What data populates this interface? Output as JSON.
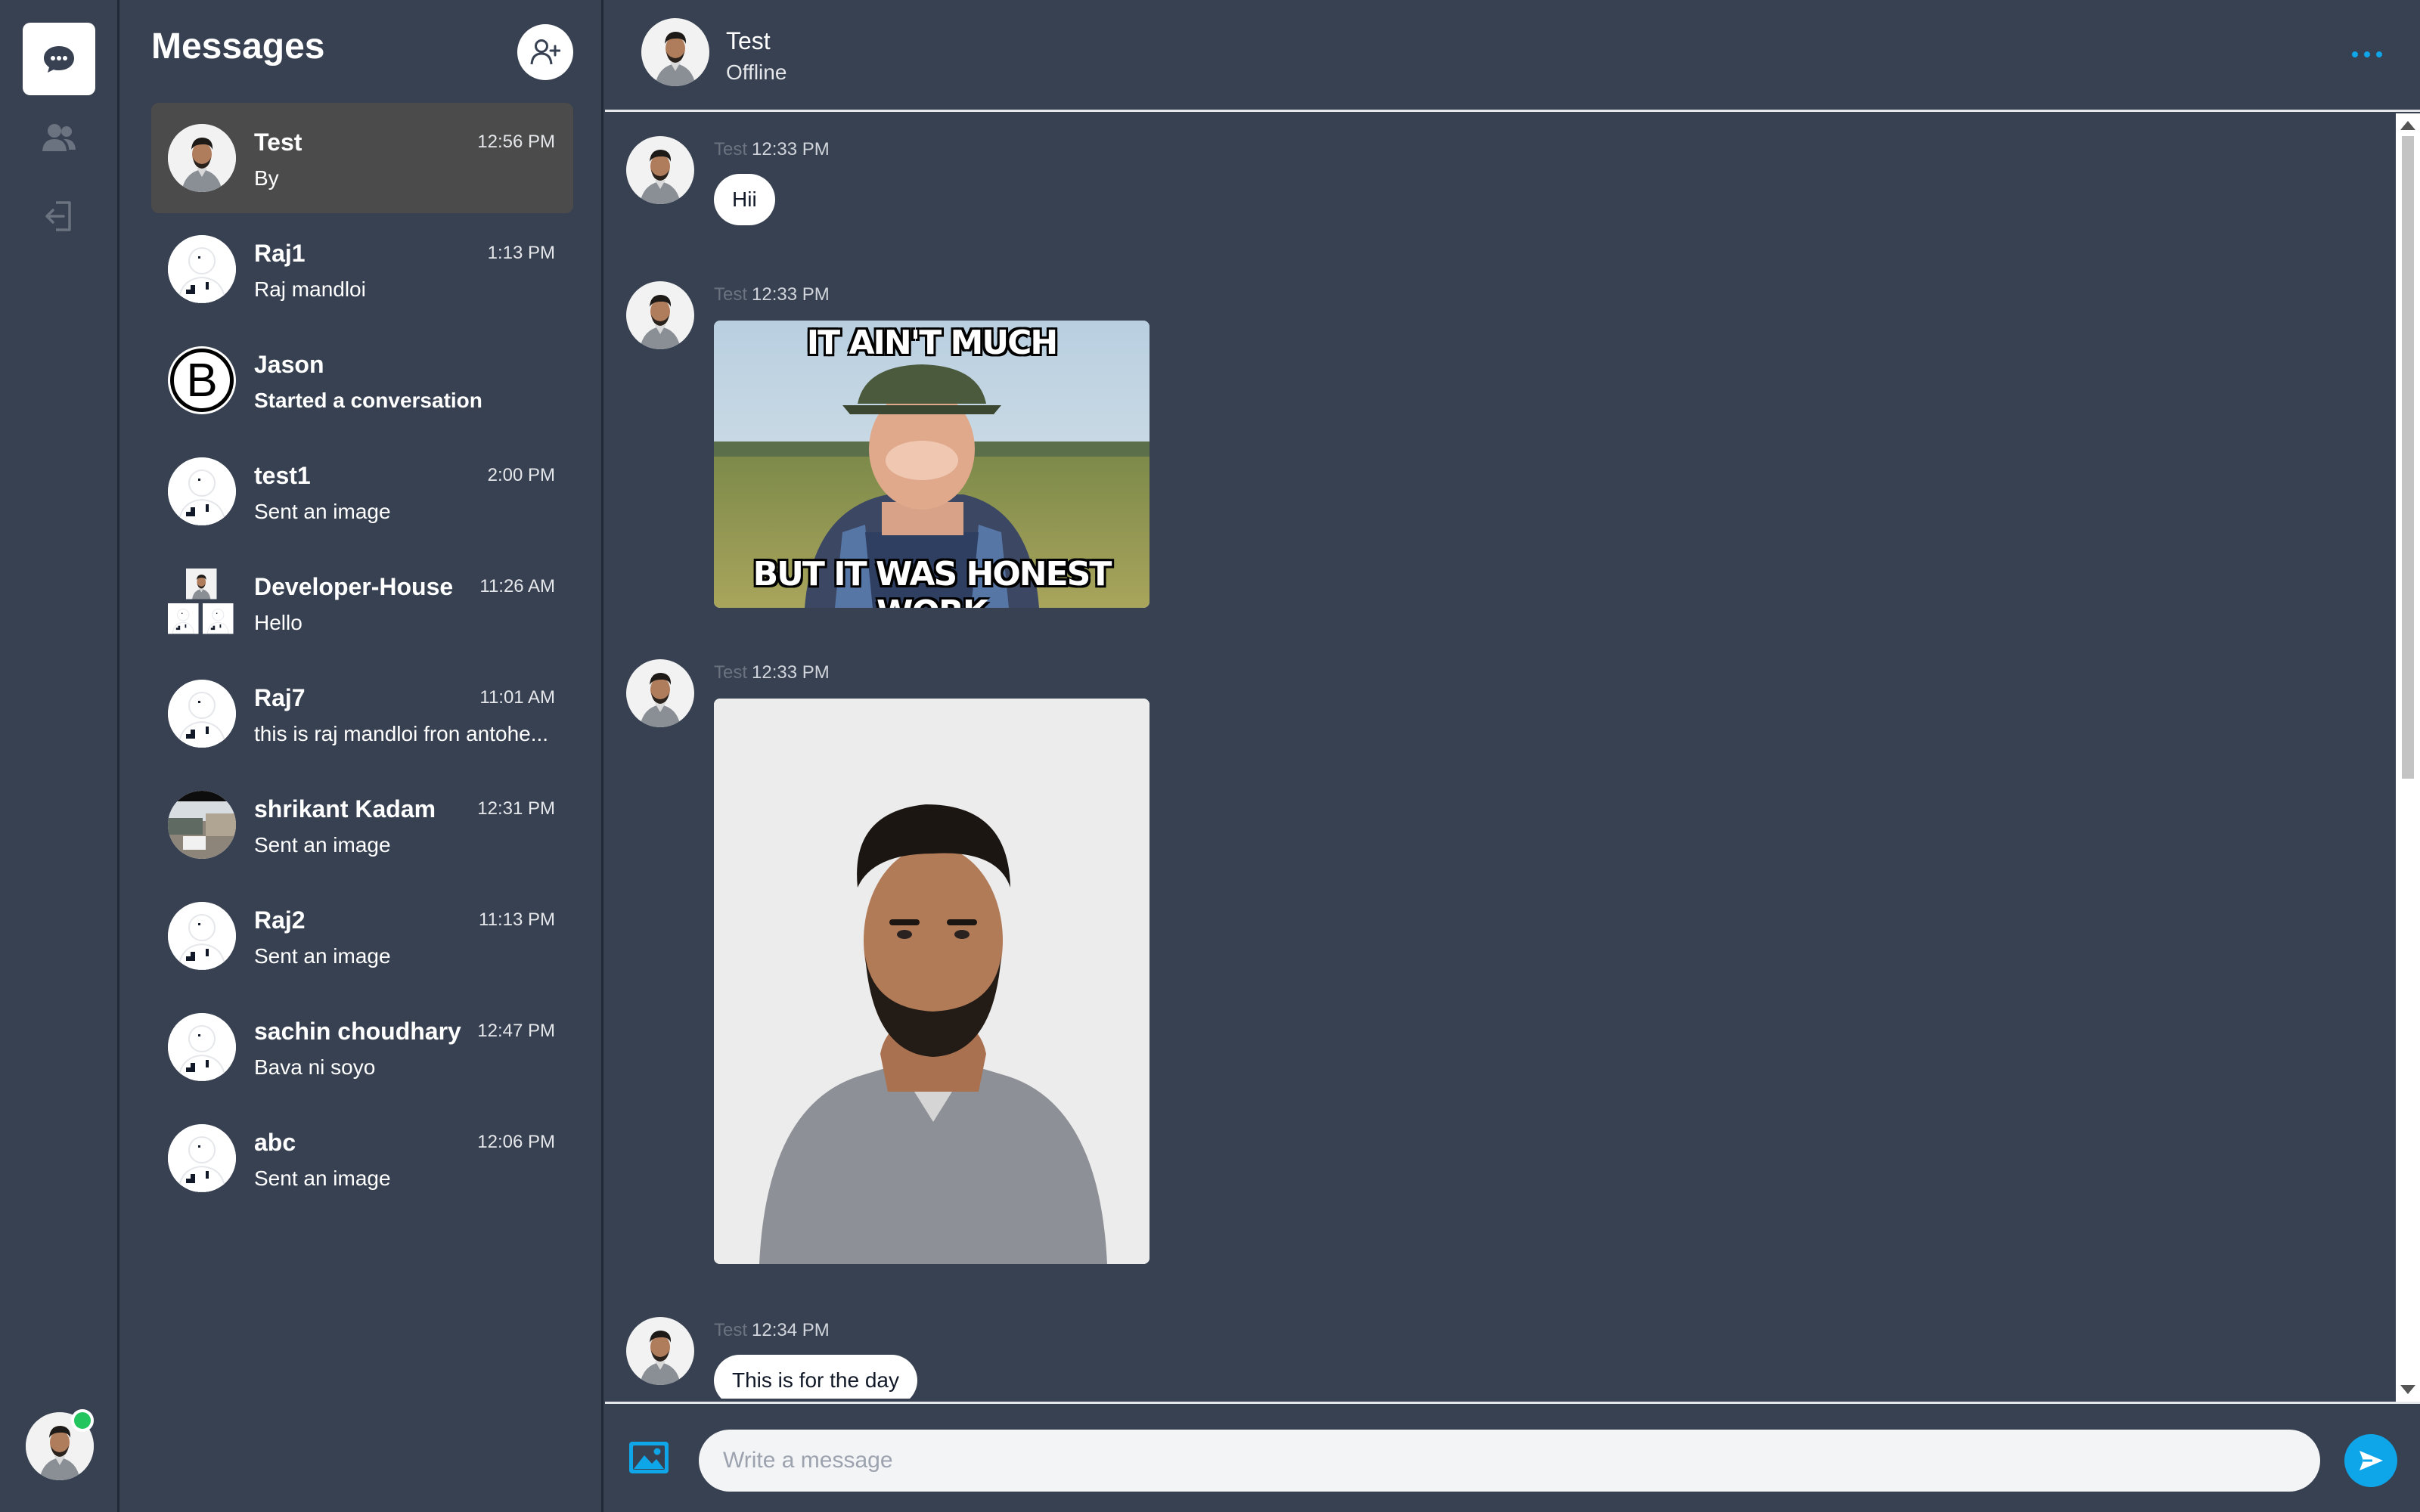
{
  "app": {
    "colors": {
      "accent": "#0ea5e9",
      "background": "#374151",
      "online": "#22c55e",
      "active_row": "#4b4b4b"
    },
    "icons": [
      "chat-bubble-icon",
      "users-icon",
      "logout-icon",
      "add-contact-icon",
      "more-dots-icon",
      "image-icon",
      "send-icon"
    ]
  },
  "rail": {
    "items": [
      {
        "name": "chats",
        "icon": "chat-bubble-icon",
        "active": true
      },
      {
        "name": "contacts",
        "icon": "users-icon",
        "active": false
      },
      {
        "name": "logout",
        "icon": "logout-icon",
        "active": false
      }
    ],
    "user_status": "online"
  },
  "conversations": {
    "title": "Messages",
    "items": [
      {
        "name": "Test",
        "preview": "By",
        "time": "12:56 PM",
        "avatar": "photo",
        "active": true
      },
      {
        "name": "Raj1",
        "preview": "Raj mandloi",
        "time": "1:13 PM",
        "avatar": "default"
      },
      {
        "name": "Jason",
        "preview": "Started a conversation",
        "time": "",
        "avatar": "letter",
        "letter": "B",
        "preview_bold": true
      },
      {
        "name": "test1",
        "preview": "Sent an image",
        "time": "2:00 PM",
        "avatar": "default"
      },
      {
        "name": "Developer-House",
        "preview": "Hello",
        "time": "11:26 AM",
        "avatar": "group"
      },
      {
        "name": "Raj7",
        "preview": "this is raj mandloi fron antohe...",
        "time": "11:01 AM",
        "avatar": "default"
      },
      {
        "name": "shrikant Kadam",
        "preview": "Sent an image",
        "time": "12:31 PM",
        "avatar": "outdoor"
      },
      {
        "name": "Raj2",
        "preview": "Sent an image",
        "time": "11:13 PM",
        "avatar": "default"
      },
      {
        "name": "sachin choudhary",
        "preview": "Bava ni soyo",
        "time": "12:47 PM",
        "avatar": "default"
      },
      {
        "name": "abc",
        "preview": "Sent an image",
        "time": "12:06 PM",
        "avatar": "default"
      }
    ]
  },
  "chat": {
    "contact_name": "Test",
    "contact_status": "Offline",
    "messages": [
      {
        "sender": "Test",
        "time": "12:33 PM",
        "type": "text",
        "text": "Hii"
      },
      {
        "sender": "Test",
        "time": "12:33 PM",
        "type": "image",
        "image": "meme",
        "caption_top": "IT AIN'T MUCH",
        "caption_bottom": "BUT IT WAS HONEST WORK"
      },
      {
        "sender": "Test",
        "time": "12:33 PM",
        "type": "image",
        "image": "portrait"
      },
      {
        "sender": "Test",
        "time": "12:34 PM",
        "type": "text",
        "text": "This is for the day"
      }
    ],
    "composer": {
      "placeholder": "Write a message",
      "value": ""
    }
  }
}
